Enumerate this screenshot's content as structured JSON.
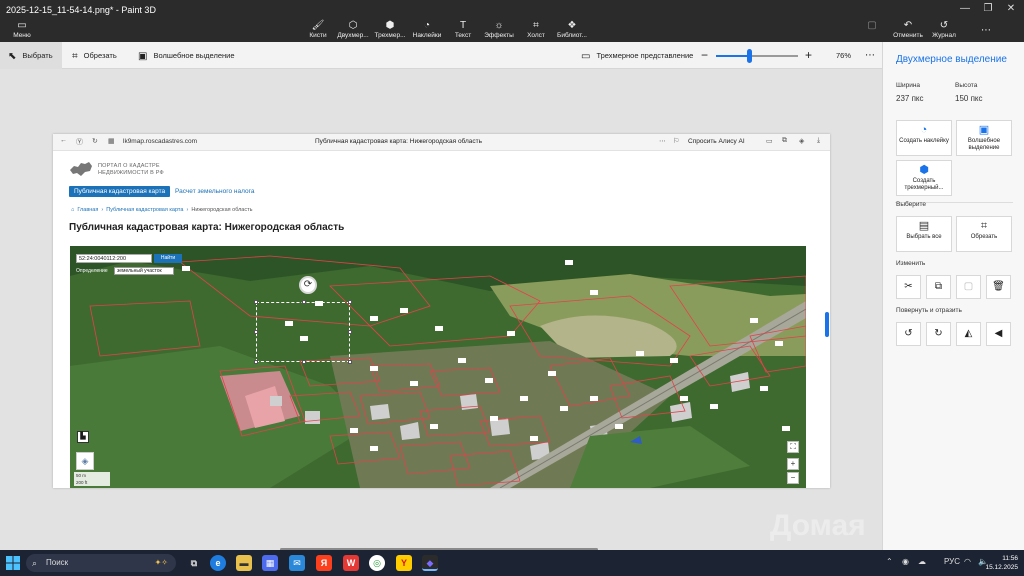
{
  "window": {
    "title": "2025-12-15_11-54-14.png* - Paint 3D"
  },
  "ribbon": {
    "menu": "Меню",
    "tools": [
      "Кисти",
      "Двухмер...",
      "Трехмер...",
      "Наклейки",
      "Текст",
      "Эффекты",
      "Холст",
      "Библиот..."
    ],
    "undo": "Отменить",
    "history": "Журнал"
  },
  "toolbar": {
    "select": "Выбрать",
    "crop": "Обрезать",
    "magic": "Волшебное выделение",
    "view3d": "Трехмерное представление",
    "zoom_percent": "76%",
    "zoom_level": 0.4
  },
  "browser": {
    "url": "lk9map.roscadastres.com",
    "page_title": "Публичная кадастровая карта: Нижегородская область",
    "ask": "Спросить Алису AI"
  },
  "site": {
    "logo_line1": "ПОРТАЛ О КАДАСТРЕ",
    "logo_line2": "НЕДВИЖИМОСТИ В РФ",
    "tab_active": "Публичная кадастровая карта",
    "tab2": "Расчет земельного налога",
    "crumb1": "Главная",
    "crumb2": "Публичная кадастровая карта",
    "crumb3": "Нижегородская область",
    "heading": "Публичная кадастровая карта: Нижегородская область"
  },
  "map": {
    "search_value": "52:24:0040112:200",
    "find_button": "Найти",
    "define_label": "Определение",
    "define_select": "земельный участок",
    "scale_m": "50 m",
    "scale_ft": "200 ft"
  },
  "panel": {
    "title": "Двухмерное выделение",
    "width_label": "Ширина",
    "width_value": "237 пкс",
    "height_label": "Высота",
    "height_value": "150 пкс",
    "btn_sticker": "Создать наклейку",
    "btn_magic": "Волшебное выделение",
    "btn_3d": "Создать трехмерный...",
    "choose_label": "Выберите",
    "btn_select_all": "Выбрать все",
    "btn_crop": "Обрезать",
    "change_label": "Изменить",
    "rotate_label": "Повернуть и отразить"
  },
  "taskbar": {
    "search": "Поиск",
    "lang": "РУС",
    "time": "11:56",
    "date": "15.12.2025"
  }
}
